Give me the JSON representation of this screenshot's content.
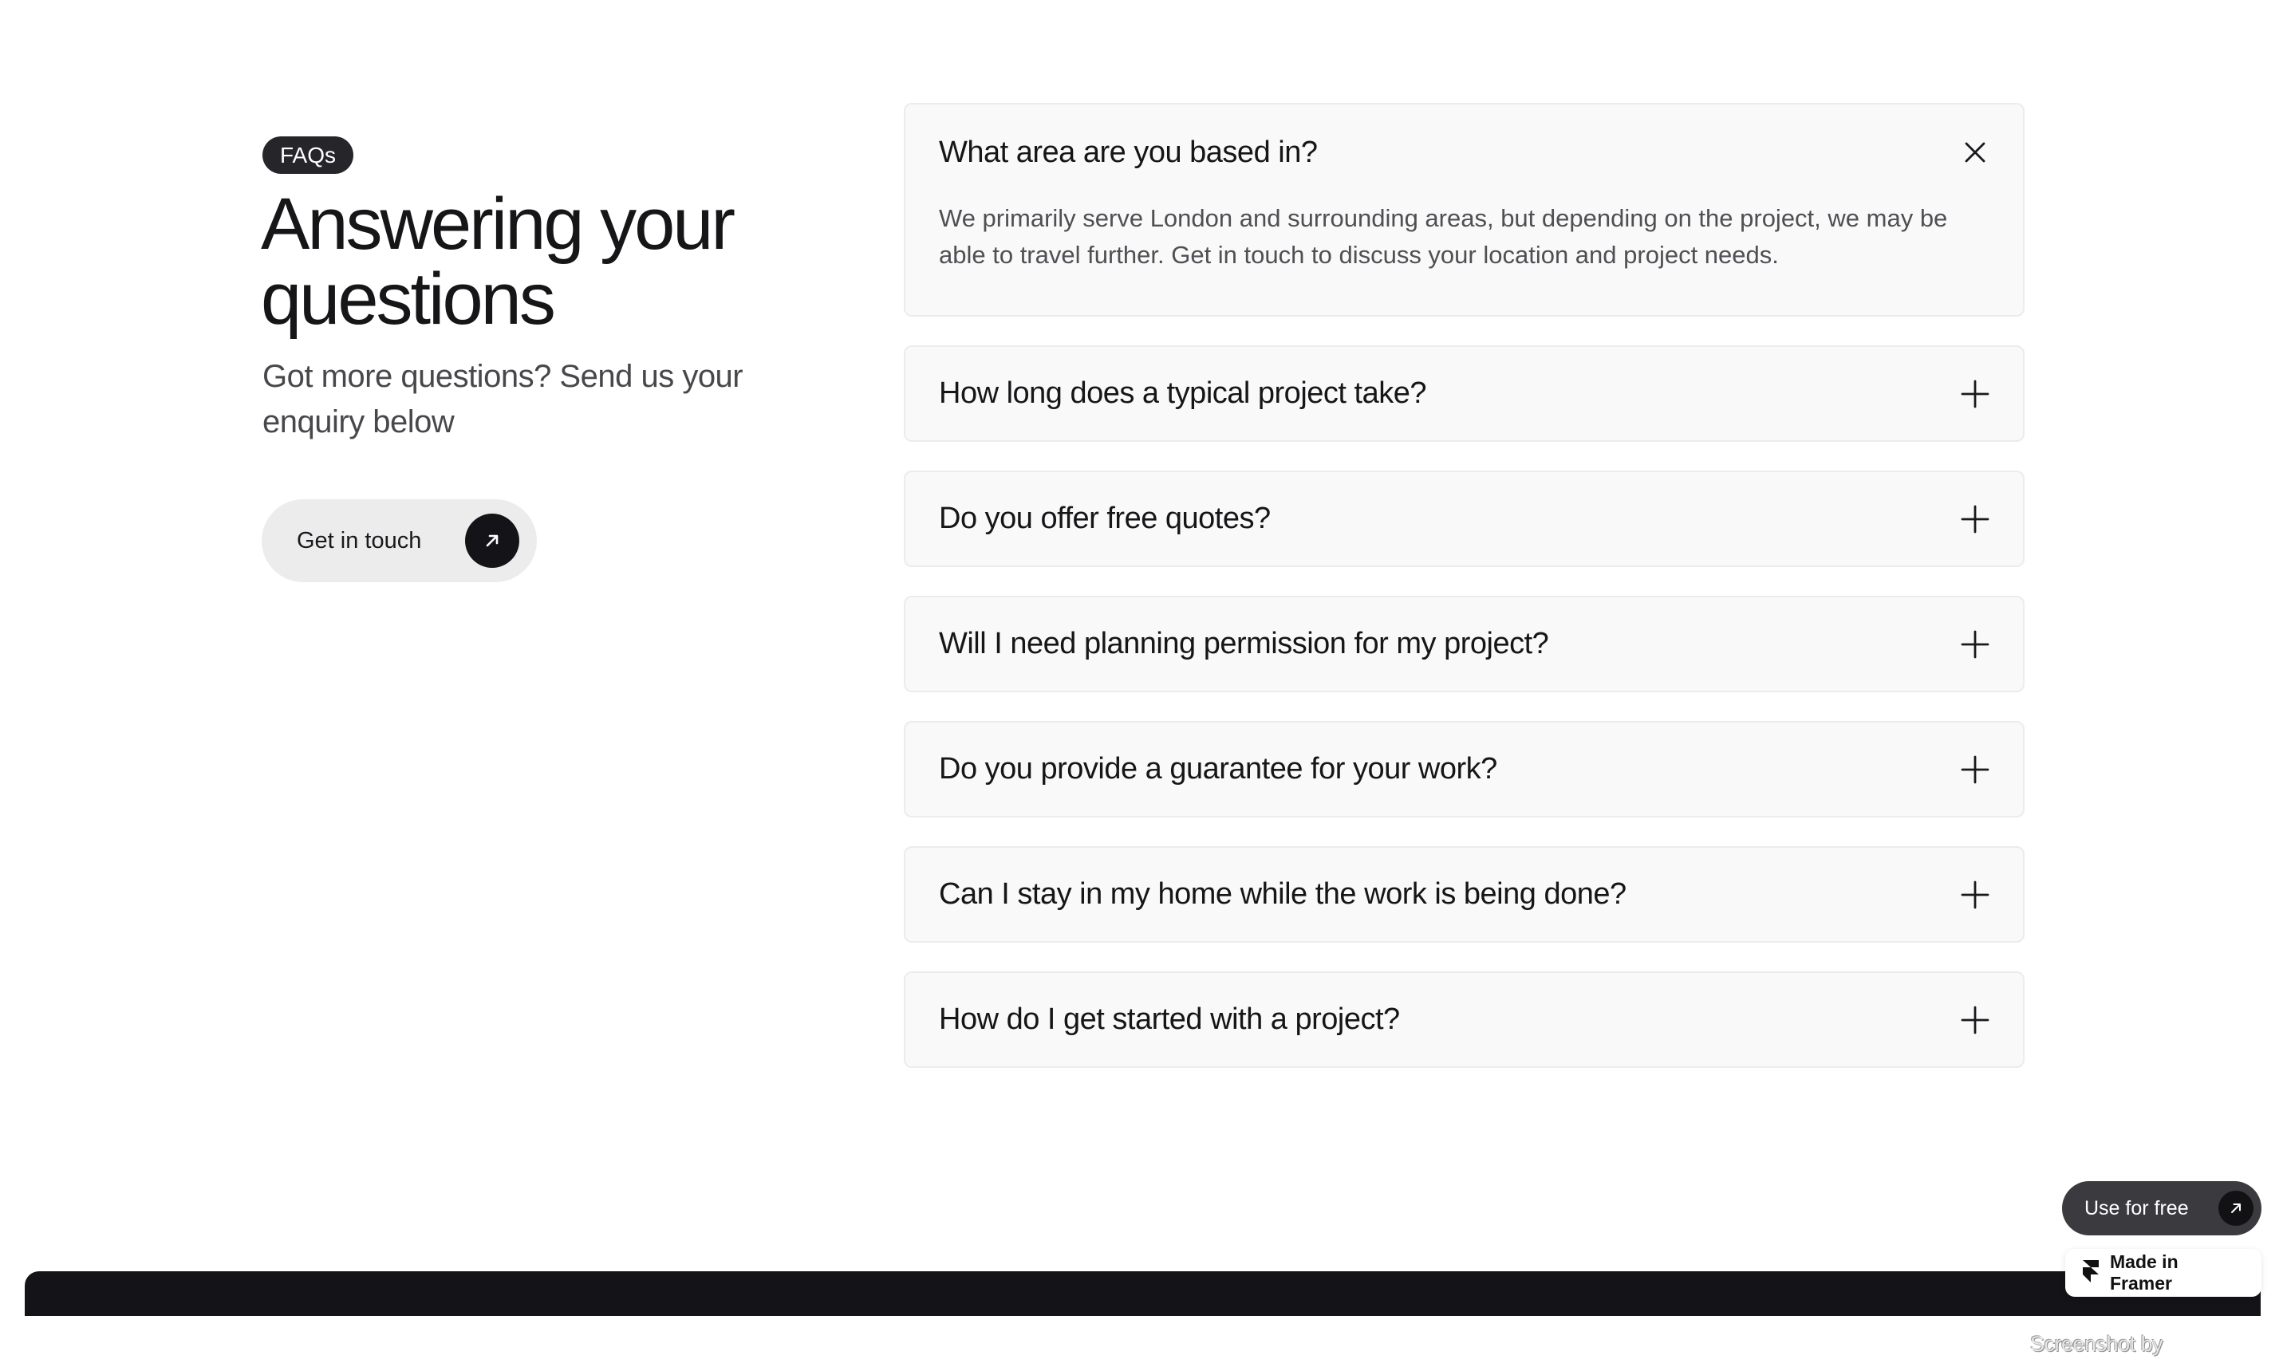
{
  "hero": {
    "badge": "FAQs",
    "title": "Answering your questions",
    "subtitle": "Got more questions? Send us your enquiry below",
    "cta_label": "Get in touch",
    "cta_icon": "arrow-up-right-icon"
  },
  "faqs": [
    {
      "question": "What area are you based in?",
      "answer": "We primarily serve London and surrounding areas, but depending on the project, we may be able to travel further. Get in touch to discuss your location and project needs.",
      "expanded": true,
      "icon": "close-icon"
    },
    {
      "question": "How long does a typical project take?",
      "expanded": false,
      "icon": "plus-icon"
    },
    {
      "question": "Do you offer free quotes?",
      "expanded": false,
      "icon": "plus-icon"
    },
    {
      "question": "Will I need planning permission for my project?",
      "expanded": false,
      "icon": "plus-icon"
    },
    {
      "question": "Do you provide a guarantee for your work?",
      "expanded": false,
      "icon": "plus-icon"
    },
    {
      "question": "Can I stay in my home while the work is being done?",
      "expanded": false,
      "icon": "plus-icon"
    },
    {
      "question": "How do I get started with a project?",
      "expanded": false,
      "icon": "plus-icon"
    }
  ],
  "framer": {
    "use_free_label": "Use for free",
    "made_in_label": "Made in Framer",
    "logo_icon": "framer-logo-icon"
  },
  "watermark": "Screenshot by Xnapper.com",
  "colors": {
    "badge_bg": "#26262a",
    "cta_bg": "#ececec",
    "dark": "#141418",
    "faq_bg": "#f9f9f9",
    "faq_border": "#ececec"
  }
}
